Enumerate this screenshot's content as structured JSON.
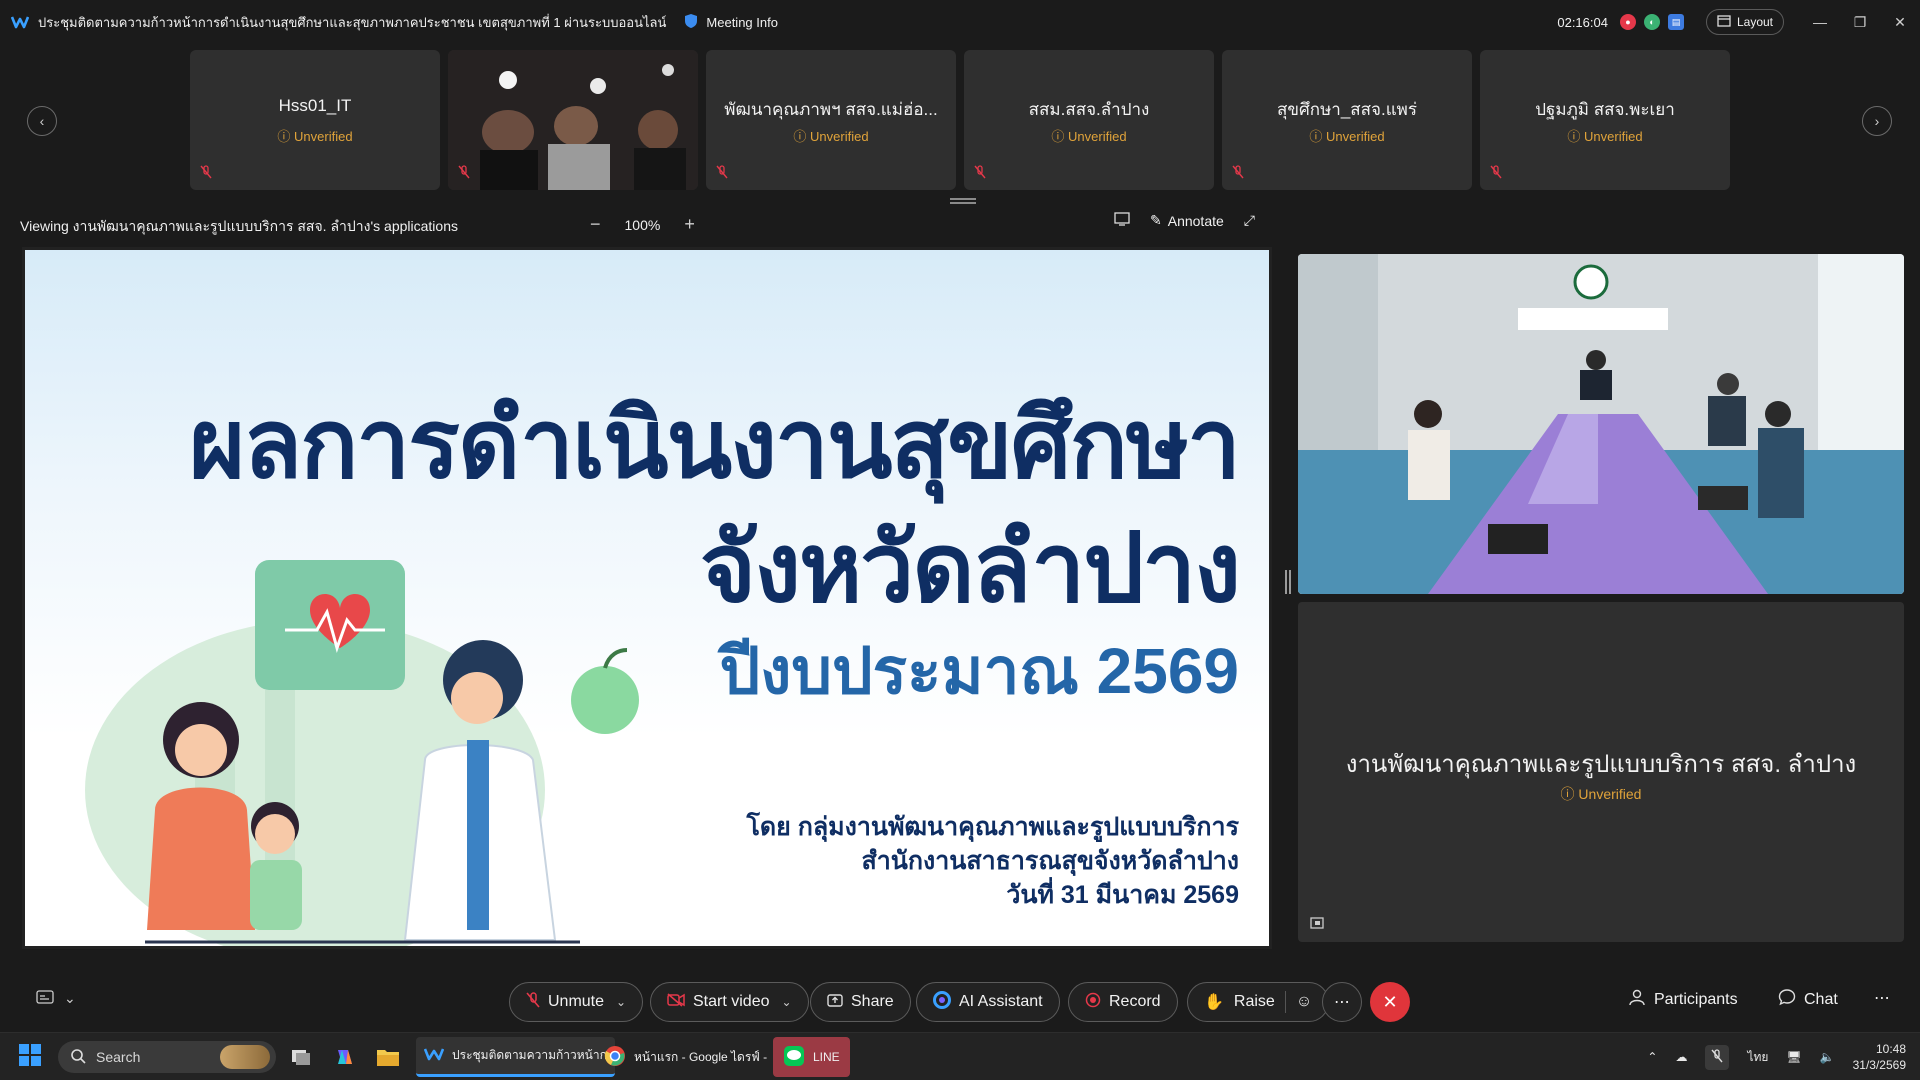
{
  "titlebar": {
    "title": "ประชุมติดตามความก้าวหน้าการดำเนินงานสุขศึกษาและสุขภาพภาคประชาชน เขตสุขภาพที่ 1 ผ่านระบบออนไลน์",
    "meeting_info": "Meeting Info",
    "timer": "02:16:04",
    "layout": "Layout"
  },
  "filmstrip": {
    "tiles": [
      {
        "name": "Hss01_IT",
        "status": "Unverified"
      },
      {
        "name": "",
        "status": ""
      },
      {
        "name": "พัฒนาคุณภาพฯ สสจ.แม่ฮ่อ...",
        "status": "Unverified"
      },
      {
        "name": "สสม.สสจ.ลำปาง",
        "status": "Unverified"
      },
      {
        "name": "สุขศึกษา_สสจ.แพร่",
        "status": "Unverified"
      },
      {
        "name": "ปฐมภูมิ สสจ.พะเยา",
        "status": "Unverified"
      }
    ]
  },
  "share": {
    "viewing": "Viewing งานพัฒนาคุณภาพและรูปแบบบริการ สสจ. ลำปาง's applications",
    "zoom": "100%",
    "annotate": "Annotate"
  },
  "slide": {
    "title_line1": "ผลการดำเนินงานสุขศึกษา",
    "title_line2": "จังหวัดลำปาง",
    "subtitle": "ปีงบประมาณ 2569",
    "by_line1": "โดย กลุ่มงานพัฒนาคุณภาพและรูปแบบบริการ",
    "by_line2": "สำนักงานสาธารณสุขจังหวัดลำปาง",
    "by_line3": "วันที่ 31 มีนาคม 2569"
  },
  "panel": {
    "participant_name": "งานพัฒนาคุณภาพและรูปแบบบริการ สสจ. ลำปาง",
    "participant_status": "Unverified"
  },
  "controls": {
    "unmute": "Unmute",
    "start_video": "Start video",
    "share": "Share",
    "ai_assistant": "AI Assistant",
    "record": "Record",
    "raise": "Raise",
    "participants": "Participants",
    "chat": "Chat"
  },
  "taskbar": {
    "search": "Search",
    "webex_app": "ประชุมติดตามความก้าวหน้าก",
    "chrome_app": "หน้าแรก - Google ไดรฟ์ -",
    "line_app": "LINE",
    "lang": "ไทย",
    "time": "10:48",
    "date": "31/3/2569"
  },
  "colors": {
    "accent_unverified": "#e0a33a",
    "end_call": "#e0353b",
    "slide_title": "#0f2e63",
    "slide_sub": "#2466a8"
  }
}
